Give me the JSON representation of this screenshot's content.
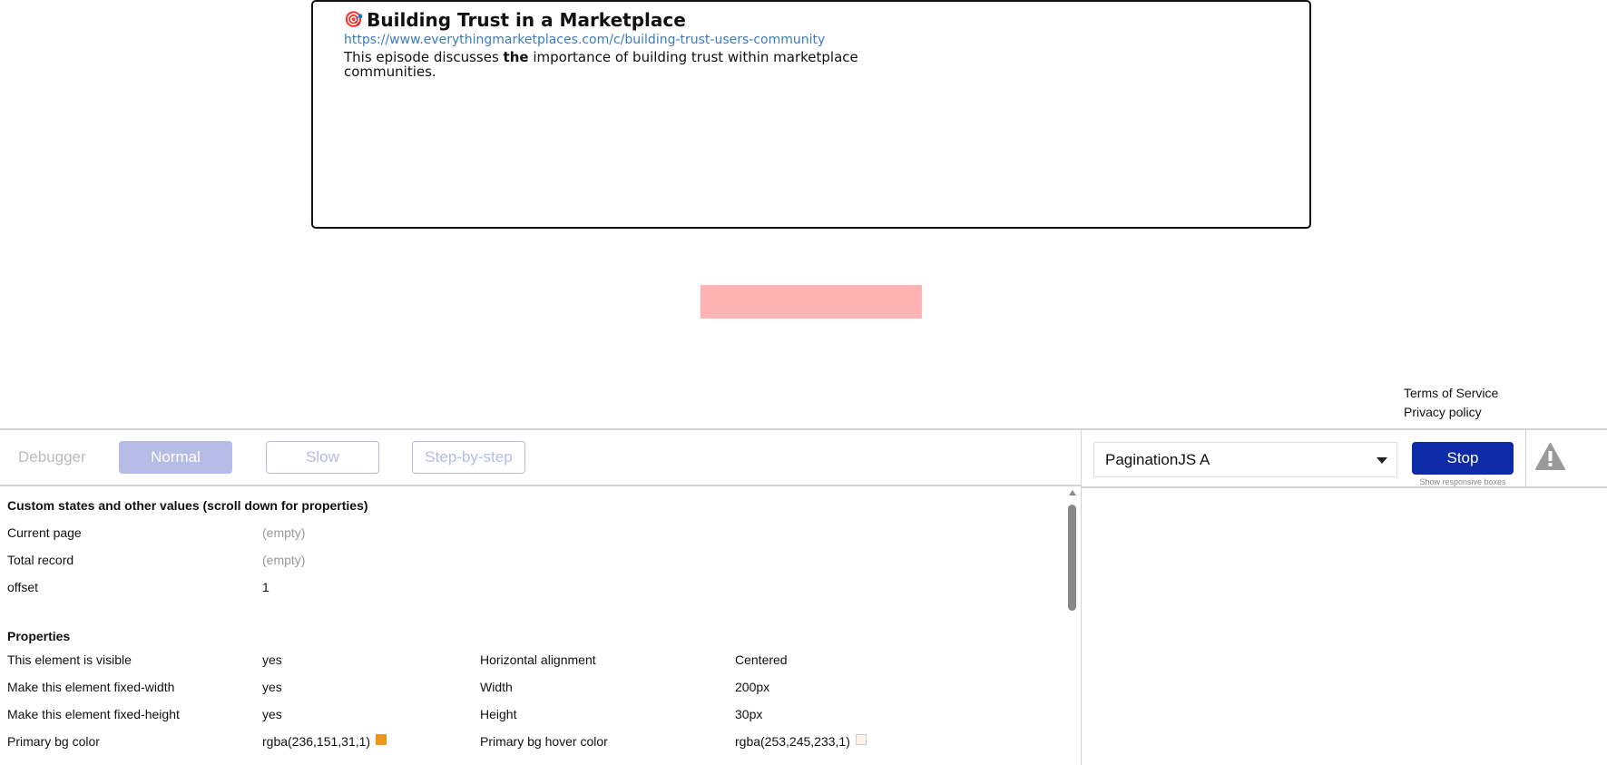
{
  "card": {
    "icon": "🎯",
    "title": "Building Trust in a Marketplace",
    "url": "https://www.everythingmarketplaces.com/c/building-trust-users-community",
    "desc_pre": "This episode discusses ",
    "desc_bold": "the",
    "desc_post": " importance of building trust within marketplace communities."
  },
  "footer": {
    "terms": "Terms of Service",
    "privacy": "Privacy policy"
  },
  "debugger": {
    "label": "Debugger",
    "normal": "Normal",
    "slow": "Slow",
    "step": "Step-by-step",
    "selected_element": "PaginationJS A",
    "stop": "Stop",
    "responsive": "Show responsive boxes"
  },
  "states": {
    "heading": "Custom states and other values (scroll down for properties)",
    "rows": [
      {
        "label": "Current page",
        "value": "(empty)"
      },
      {
        "label": "Total record",
        "value": "(empty)"
      },
      {
        "label": "offset",
        "value": "1"
      }
    ]
  },
  "properties": {
    "heading": "Properties",
    "rows": [
      {
        "label": "This element is visible",
        "value": "yes",
        "label2": "Horizontal alignment",
        "value2": "Centered"
      },
      {
        "label": "Make this element fixed-width",
        "value": "yes",
        "label2": "Width",
        "value2": "200px"
      },
      {
        "label": "Make this element fixed-height",
        "value": "yes",
        "label2": "Height",
        "value2": "30px"
      },
      {
        "label": "Primary bg color",
        "value": "rgba(236,151,31,1)",
        "label2": "Primary bg hover color",
        "value2": "rgba(253,245,233,1)"
      }
    ],
    "swatch1": "#ec971f",
    "swatch2": "#fdf5e9"
  }
}
